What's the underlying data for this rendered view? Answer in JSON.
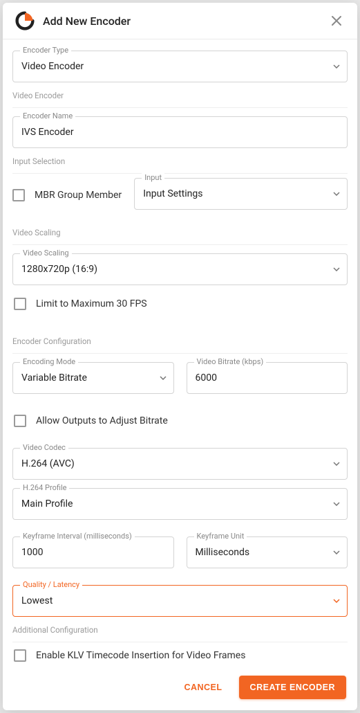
{
  "dialog": {
    "title": "Add New Encoder"
  },
  "encoder_type": {
    "label": "Encoder Type",
    "value": "Video Encoder"
  },
  "sections": {
    "video_encoder": "Video Encoder",
    "input_selection": "Input Selection",
    "video_scaling": "Video Scaling",
    "encoder_config": "Encoder Configuration",
    "additional_config": "Additional Configuration"
  },
  "encoder_name": {
    "label": "Encoder Name",
    "value": "IVS Encoder"
  },
  "mbr_checkbox": {
    "label": "MBR Group Member",
    "checked": false
  },
  "input": {
    "label": "Input",
    "value": "Input Settings"
  },
  "video_scaling": {
    "label": "Video Scaling",
    "value": "1280x720p (16:9)"
  },
  "limit_fps": {
    "label": "Limit to Maximum 30 FPS",
    "checked": false
  },
  "encoding_mode": {
    "label": "Encoding Mode",
    "value": "Variable Bitrate"
  },
  "video_bitrate": {
    "label": "Video Bitrate (kbps)",
    "value": "6000"
  },
  "allow_adjust": {
    "label": "Allow Outputs to Adjust Bitrate",
    "checked": false
  },
  "video_codec": {
    "label": "Video Codec",
    "value": "H.264 (AVC)"
  },
  "h264_profile": {
    "label": "H.264 Profile",
    "value": "Main Profile"
  },
  "keyframe_interval": {
    "label": "Keyframe Interval (milliseconds)",
    "value": "1000"
  },
  "keyframe_unit": {
    "label": "Keyframe Unit",
    "value": "Milliseconds"
  },
  "quality_latency": {
    "label": "Quality / Latency",
    "value": "Lowest"
  },
  "klv": {
    "label": "Enable KLV Timecode Insertion for Video Frames",
    "checked": false
  },
  "buttons": {
    "cancel": "CANCEL",
    "create": "CREATE ENCODER"
  }
}
